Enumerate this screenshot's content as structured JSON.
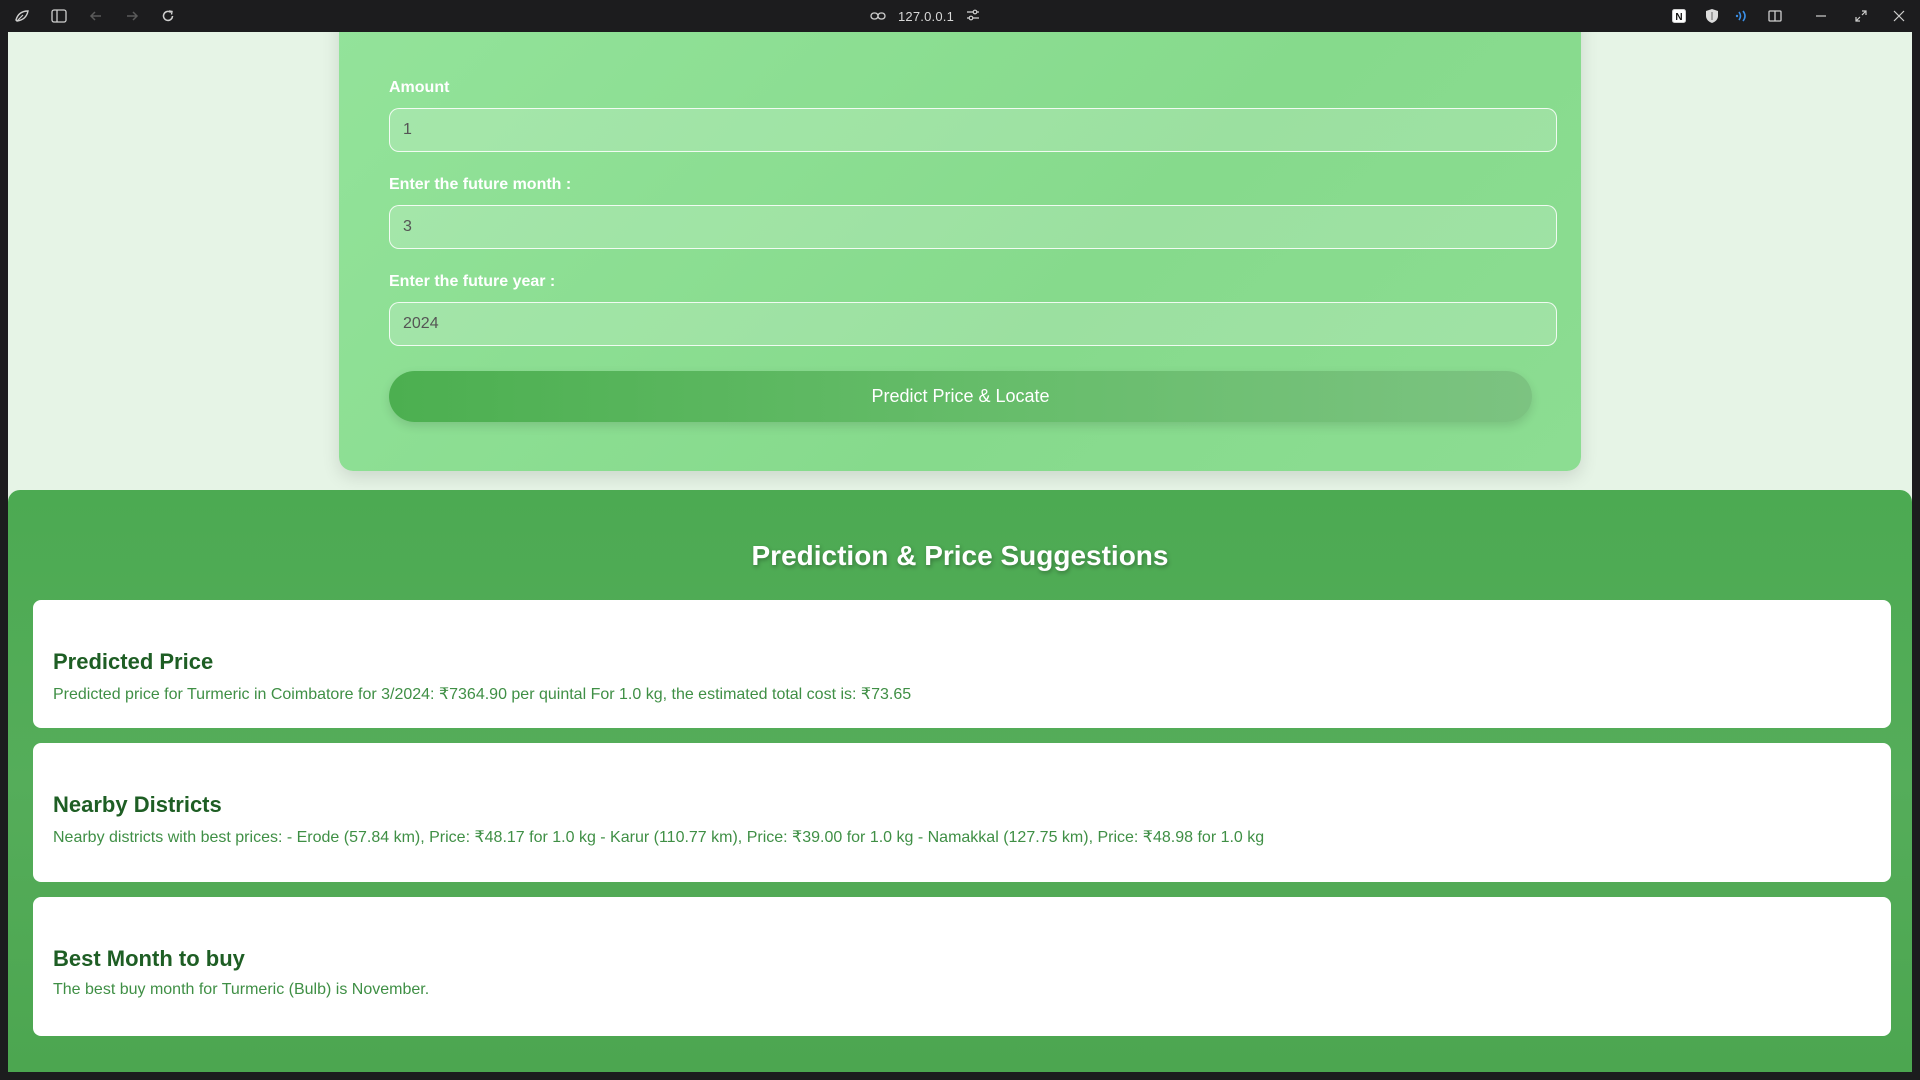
{
  "browser": {
    "url": "127.0.0.1",
    "icons": {
      "app": "leaf-logo-icon",
      "sidebar": "sidebar-icon",
      "back": "arrow-left-icon",
      "forward": "arrow-right-icon",
      "reload": "reload-icon",
      "link": "link-icon",
      "settings": "sliders-icon",
      "ext1": "notion-icon",
      "ext2": "shield-icon",
      "ext3": "wave-icon",
      "split": "split-view-icon",
      "minimize": "minimize-icon",
      "restore": "restore-icon",
      "close": "close-icon"
    }
  },
  "form": {
    "amount_label": "Amount",
    "amount_value": "1",
    "month_label": "Enter the future month :",
    "month_value": "3",
    "year_label": "Enter the future year :",
    "year_value": "2024",
    "submit_label": "Predict Price & Locate"
  },
  "results": {
    "title": "Prediction & Price Suggestions",
    "cards": [
      {
        "heading": "Predicted Price",
        "text": "Predicted price for Turmeric in Coimbatore for 3/2024: ₹7364.90 per quintal For 1.0 kg, the estimated total cost is: ₹73.65"
      },
      {
        "heading": "Nearby Districts",
        "text": "Nearby districts with best prices: - Erode (57.84 km), Price: ₹48.17 for 1.0 kg - Karur (110.77 km), Price: ₹39.00 for 1.0 kg - Namakkal (127.75 km), Price: ₹48.98 for 1.0 kg"
      },
      {
        "heading": "Best Month to buy",
        "text": "The best buy month for Turmeric (Bulb) is November."
      }
    ]
  },
  "colors": {
    "form_bg": "#8ade90",
    "results_bg": "#4caa52",
    "heading": "#1e5e24",
    "text": "#3f8f45"
  }
}
